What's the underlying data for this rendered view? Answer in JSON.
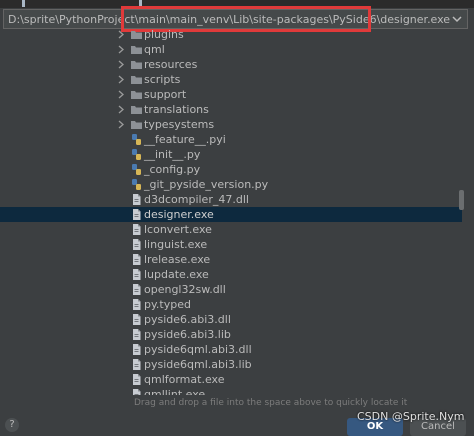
{
  "path_field": {
    "value": "D:\\sprite\\PythonProject\\main\\main_venv\\Lib\\site-packages\\PySide6\\designer.exe"
  },
  "tree_items": [
    {
      "type": "folder",
      "label": "plugins"
    },
    {
      "type": "folder",
      "label": "qml"
    },
    {
      "type": "folder",
      "label": "resources"
    },
    {
      "type": "folder",
      "label": "scripts"
    },
    {
      "type": "folder",
      "label": "support"
    },
    {
      "type": "folder",
      "label": "translations"
    },
    {
      "type": "folder",
      "label": "typesystems"
    },
    {
      "type": "python",
      "label": "__feature__.pyi"
    },
    {
      "type": "python",
      "label": "__init__.py"
    },
    {
      "type": "python",
      "label": "_config.py"
    },
    {
      "type": "python",
      "label": "_git_pyside_version.py"
    },
    {
      "type": "file",
      "label": "d3dcompiler_47.dll"
    },
    {
      "type": "file",
      "label": "designer.exe",
      "selected": true
    },
    {
      "type": "file",
      "label": "lconvert.exe"
    },
    {
      "type": "file",
      "label": "linguist.exe"
    },
    {
      "type": "file",
      "label": "lrelease.exe"
    },
    {
      "type": "file",
      "label": "lupdate.exe"
    },
    {
      "type": "file",
      "label": "opengl32sw.dll"
    },
    {
      "type": "file",
      "label": "py.typed"
    },
    {
      "type": "file",
      "label": "pyside6.abi3.dll"
    },
    {
      "type": "file",
      "label": "pyside6.abi3.lib"
    },
    {
      "type": "file",
      "label": "pyside6qml.abi3.dll"
    },
    {
      "type": "file",
      "label": "pyside6qml.abi3.lib"
    },
    {
      "type": "file",
      "label": "qmlformat.exe"
    },
    {
      "type": "file",
      "label": "qmllint.exe"
    }
  ],
  "hint": "Drag and drop a file into the space above to quickly locate it",
  "buttons": {
    "help": "?",
    "ok": "OK",
    "cancel": "Cancel"
  },
  "watermark": "CSDN @Sprite.Nym",
  "colors": {
    "selection": "#0d293e",
    "highlight_box": "#e03a3a",
    "ok_button": "#365880"
  },
  "icons": {
    "folder": "folder-icon",
    "python": "python-file-icon",
    "file": "file-icon"
  }
}
